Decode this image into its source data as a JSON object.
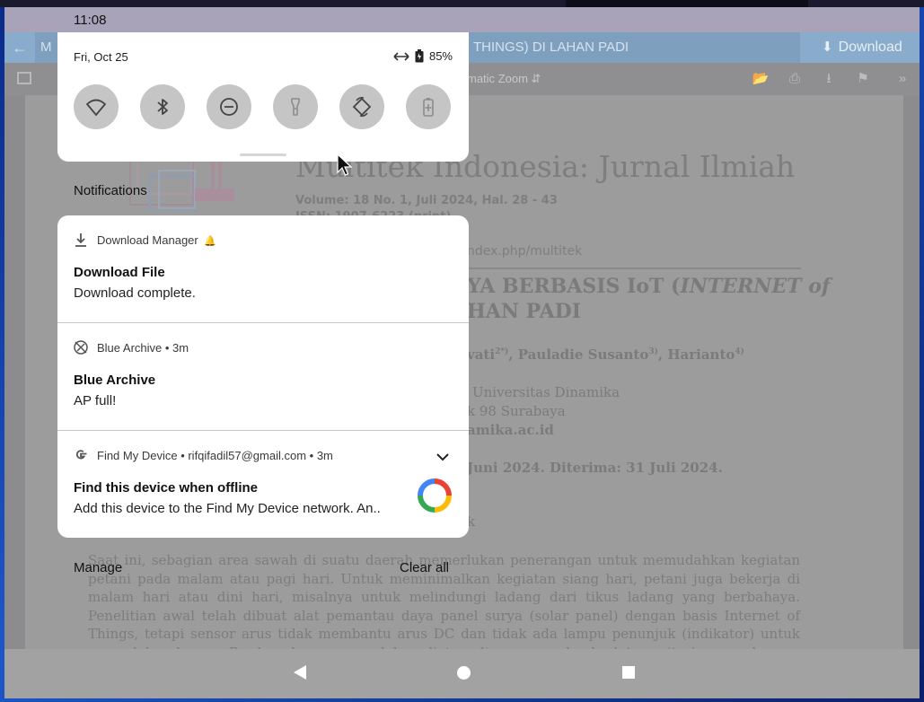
{
  "status_bar": {
    "time": "11:08"
  },
  "pdf_viewer": {
    "title_lead": "M",
    "title_tail": "THINGS) DI LAHAN PADI",
    "download_label": "Download",
    "zoom_label": "matic Zoom",
    "journal_name": "Multitek Indonesia: Jurnal Ilmiah",
    "volume": "Volume: 18 No. 1, Juli 2024, Hal.  28 - 43",
    "issn": "ISSN: 1907-6223 (print)",
    "url": "ndex.php/multitek",
    "title_line1_a": "YA BERBASIS IoT (",
    "title_line1_b": "INTERNET of",
    "title_line2": "HAN PADI",
    "authors_a": "vati",
    "authors_sup_a": "2*)",
    "authors_b": ", Pauladie Susanto",
    "authors_sup_b": "3)",
    "authors_c": ", Harianto",
    "authors_sup_c": "4)",
    "affil_1": "Universitas Dinamika",
    "affil_2": "k 98 Surabaya",
    "affil_3": "amika.ac.id",
    "dates": "Juni 2024.    Diterima: 31 Juli 2024.",
    "kata_kunci": "k",
    "abstract": "Saat ini, sebagian area sawah di suatu daerah memerlukan penerangan untuk memudahkan kegiatan petani pada malam atau pagi hari. Untuk meminimalkan kegiatan siang hari, petani juga bekerja di malam hari atau dini hari, misalnya untuk melindungi ladang dari tikus ladang yang berbahaya. Penelitian awal telah dibuat alat pemantau daya panel surya (solar panel) dengan basis Internet of Things, tetapi sensor arus tidak membantu arus DC dan tidak ada lampu penunjuk (indikator) untuk menyalakan lampu. Berdasarkan permasalahan diatas, dirancang sebuah alat monitoring panel surya dengan basis Internet of Things sehingga"
  },
  "quick_settings": {
    "date": "Fri, Oct 25",
    "battery": "85%",
    "tiles": [
      "wifi-icon",
      "bluetooth-icon",
      "do-not-disturb-icon",
      "flashlight-icon",
      "auto-rotate-icon",
      "battery-saver-icon"
    ]
  },
  "notifications": {
    "header": "Notifications",
    "items": [
      {
        "app": "Download Manager",
        "title": "Download File",
        "text": "Download complete."
      },
      {
        "app": "Blue Archive • 3m",
        "title": "Blue Archive",
        "text": "AP full!"
      },
      {
        "app": "Find My Device • rifqifadil57@gmail.com • 3m",
        "title": "Find this device when offline",
        "text": "Add this device to the Find My Device network. An.."
      }
    ],
    "manage_label": "Manage",
    "clear_all_label": "Clear all"
  },
  "colors": {
    "shade_bg": "#ffffff",
    "tile_bg": "#c5c5c5",
    "scrim": "#9fa0a8",
    "nav_bar": "#a2a2a2"
  }
}
